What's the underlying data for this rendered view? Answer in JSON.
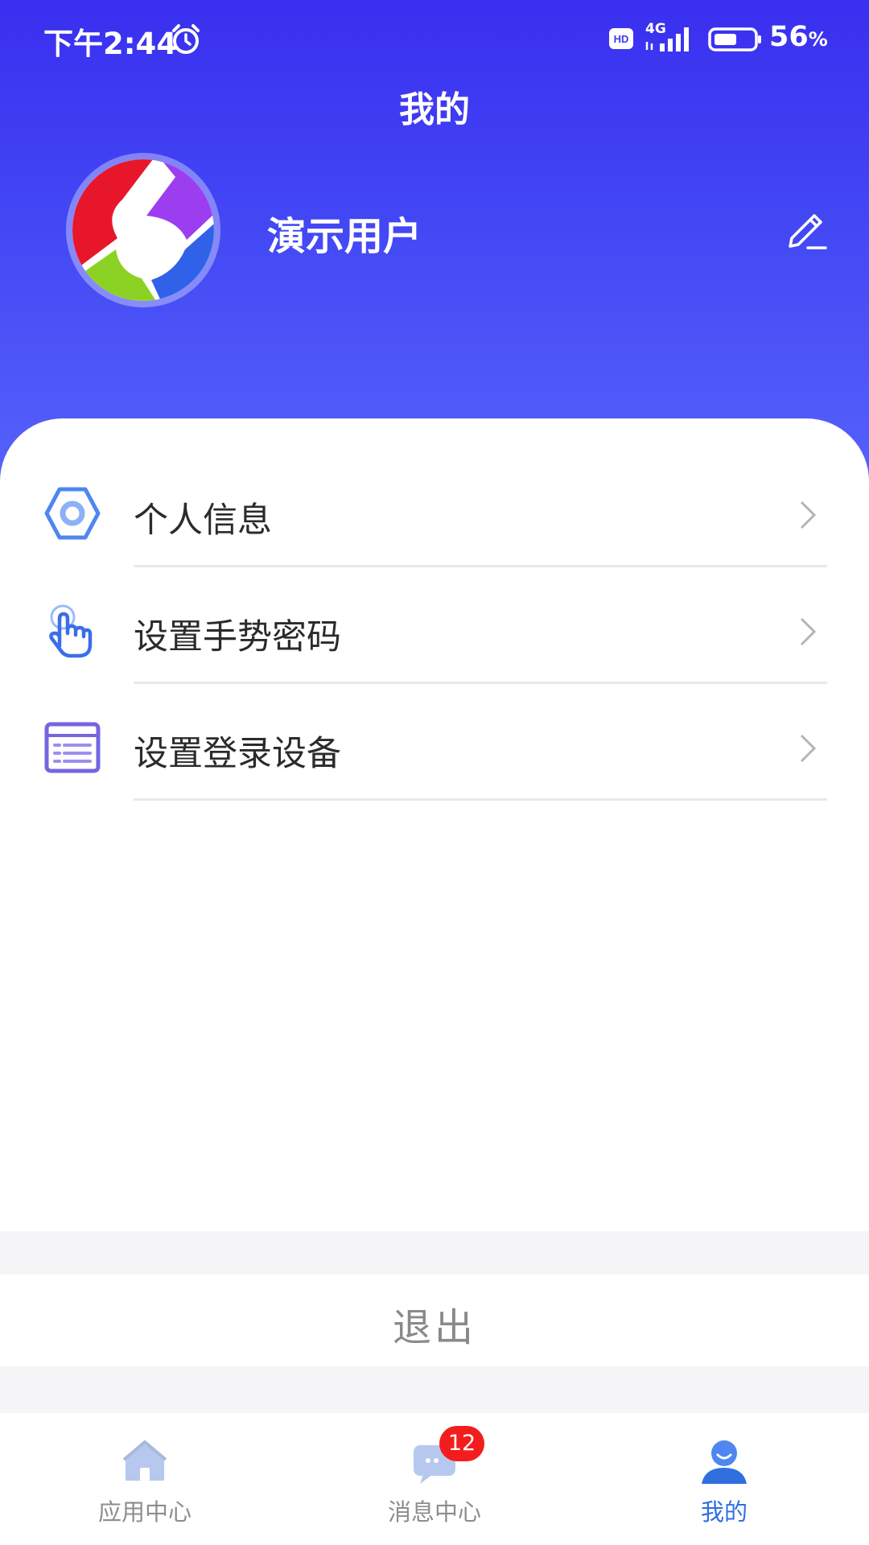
{
  "status_bar": {
    "time": "下午2:44",
    "network": "4G",
    "battery_value": "56",
    "battery_unit": "%",
    "icons": [
      "alarm-icon",
      "hd-icon",
      "signal-icon",
      "battery-icon"
    ]
  },
  "header": {
    "title": "我的",
    "user_name": "演示用户",
    "edit_icon": "edit-pencil-icon",
    "colors": {
      "gradient_top": "#3a2ff0",
      "gradient_bottom": "#5661fb"
    }
  },
  "menu": {
    "items": [
      {
        "label": "个人信息",
        "icon": "hexagon-settings-icon"
      },
      {
        "label": "设置手势密码",
        "icon": "hand-pointer-icon"
      },
      {
        "label": "设置登录设备",
        "icon": "device-list-icon"
      }
    ]
  },
  "logout": {
    "label": "退出"
  },
  "tabbar": {
    "tabs": [
      {
        "label": "应用中心",
        "icon": "home-icon",
        "active": false
      },
      {
        "label": "消息中心",
        "icon": "message-icon",
        "active": false,
        "badge": "12"
      },
      {
        "label": "我的",
        "icon": "user-icon",
        "active": true
      }
    ],
    "colors": {
      "active": "#2f6fe0",
      "inactive": "#8d8d8d",
      "badge": "#f31d1d"
    }
  }
}
